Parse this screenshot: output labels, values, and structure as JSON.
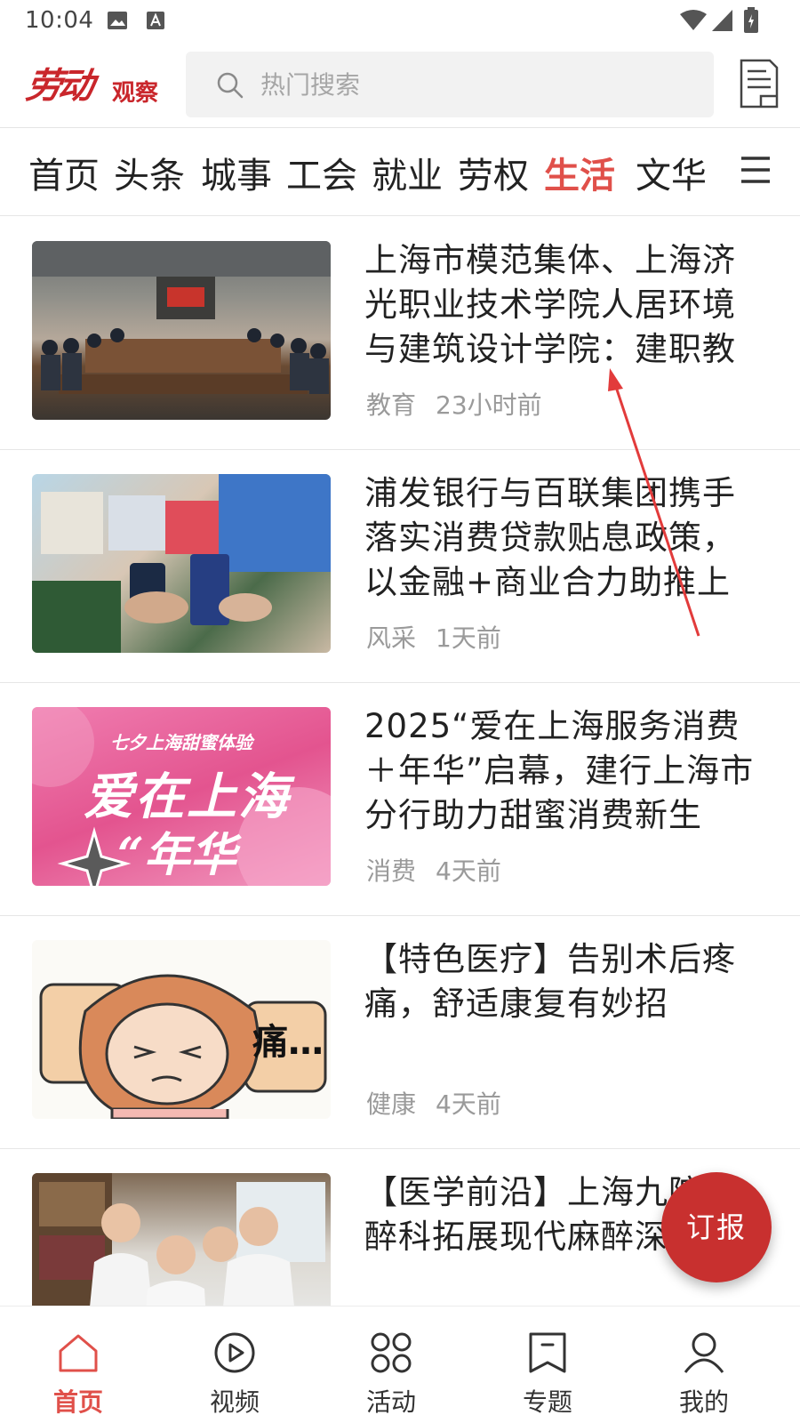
{
  "status": {
    "time": "10:04"
  },
  "header": {
    "logo_script": "劳动",
    "logo_sub": "观察",
    "search_placeholder": "热门搜索"
  },
  "tabs": [
    {
      "label": "首页",
      "active": false
    },
    {
      "label": "头条",
      "active": false
    },
    {
      "label": "城事",
      "active": false
    },
    {
      "label": "工会",
      "active": false
    },
    {
      "label": "就业",
      "active": false
    },
    {
      "label": "劳权",
      "active": false
    },
    {
      "label": "生活",
      "active": true
    },
    {
      "label": "文华",
      "active": false
    }
  ],
  "articles": [
    {
      "title": "上海市模范集体、上海济光职业技术学院人居环境与建筑设计学院：建职教",
      "category": "教育",
      "time": "23小时前"
    },
    {
      "title": "浦发银行与百联集团携手落实消费贷款贴息政策，以金融+商业合力助推上",
      "category": "风采",
      "time": "1天前"
    },
    {
      "title": "2025“爱在上海服务消费＋年华”启幕，建行上海市分行助力甜蜜消费新生",
      "category": "消费",
      "time": "4天前",
      "image_caption_top": "七夕上海甜蜜体验",
      "image_caption_main": "爱在上海",
      "image_caption_bottom": "“年华"
    },
    {
      "title": "【特色医疗】告别术后疼痛，舒适康复有妙招",
      "category": "健康",
      "time": "4天前",
      "image_text": "痛…"
    },
    {
      "title": "【医学前沿】上海九院麻醉科拓展现代麻醉深",
      "category": "",
      "time": ""
    }
  ],
  "fab": {
    "label": "订报"
  },
  "bottom_nav": [
    {
      "label": "首页",
      "icon": "home-icon",
      "active": true
    },
    {
      "label": "视频",
      "icon": "play-icon",
      "active": false
    },
    {
      "label": "活动",
      "icon": "grid-icon",
      "active": false
    },
    {
      "label": "专题",
      "icon": "bookmark-icon",
      "active": false
    },
    {
      "label": "我的",
      "icon": "user-icon",
      "active": false
    }
  ],
  "colors": {
    "accent": "#e0504a",
    "brand": "#c9262b",
    "fab": "#c8302f"
  }
}
